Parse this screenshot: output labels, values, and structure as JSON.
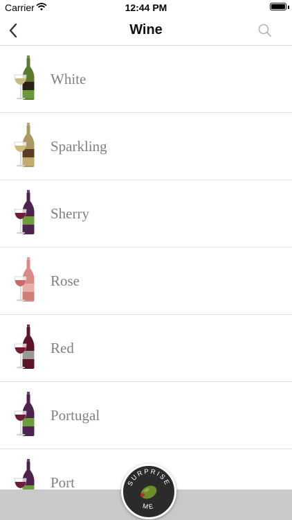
{
  "status_bar": {
    "carrier": "Carrier",
    "time": "12:44 PM"
  },
  "nav": {
    "title": "Wine",
    "back_icon": "chevron-left-icon",
    "search_icon": "search-icon"
  },
  "categories": [
    {
      "label": "White",
      "bottle": "#5c7a2c",
      "glass": "#c9b97a",
      "band_top": "#2b1f1a",
      "band_bottom": "#6a9a3a"
    },
    {
      "label": "Sparkling",
      "bottle": "#a89a60",
      "glass": "#cdbb7e",
      "band_top": "#5a3d24",
      "band_bottom": "#c2ab6c"
    },
    {
      "label": "Sherry",
      "bottle": "#4e2350",
      "glass": "#6e1e3a",
      "band_top": "#6d9e3a",
      "band_bottom": "#4e2350"
    },
    {
      "label": "Rose",
      "bottle": "#d88a86",
      "glass": "#c76c6a",
      "band_top": "#e7b0a6",
      "band_bottom": "#d27c76"
    },
    {
      "label": "Red",
      "bottle": "#5a1626",
      "glass": "#7a1a2e",
      "band_top": "#9a9a9a",
      "band_bottom": "#5a1626"
    },
    {
      "label": "Portugal",
      "bottle": "#4e2350",
      "glass": "#6e1e3a",
      "band_top": "#6d9e3a",
      "band_bottom": "#4e2350"
    },
    {
      "label": "Port",
      "bottle": "#4e2350",
      "glass": "#6e1e3a",
      "band_top": "#6d9e3a",
      "band_bottom": "#4e2350"
    }
  ],
  "surprise": {
    "text_top": "SURPRISE",
    "text_bottom": "ME",
    "icon": "olive-icon"
  }
}
